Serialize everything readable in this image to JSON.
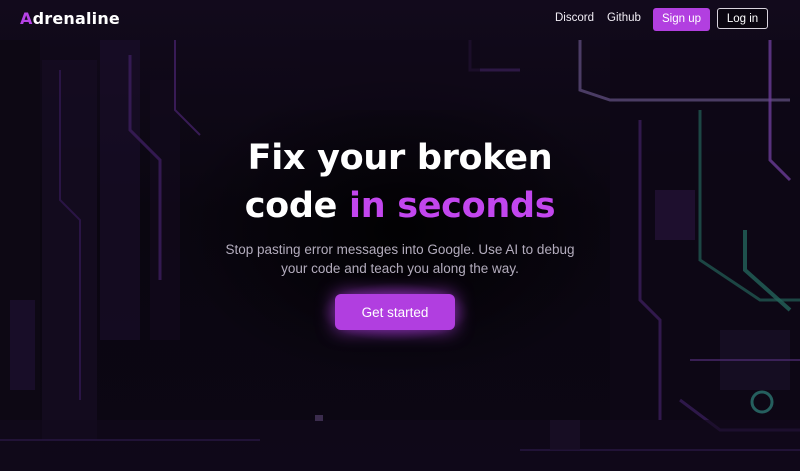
{
  "brand": {
    "first_letter": "A",
    "rest": "drenaline",
    "accent_color": "#b642e6"
  },
  "nav": {
    "discord_label": "Discord",
    "github_label": "Github",
    "signup_label": "Sign up",
    "login_label": "Log in"
  },
  "hero": {
    "title_line1": "Fix your broken",
    "title_line2_plain": "code",
    "title_line2_accent": "in seconds",
    "subtitle": "Stop pasting error messages into Google. Use AI to debug your code and teach you along the way.",
    "cta_label": "Get started"
  },
  "colors": {
    "background": "#07040b",
    "accent": "#b23fe0",
    "accent_text": "#c246ee",
    "subtitle_text": "#b3acbd"
  }
}
